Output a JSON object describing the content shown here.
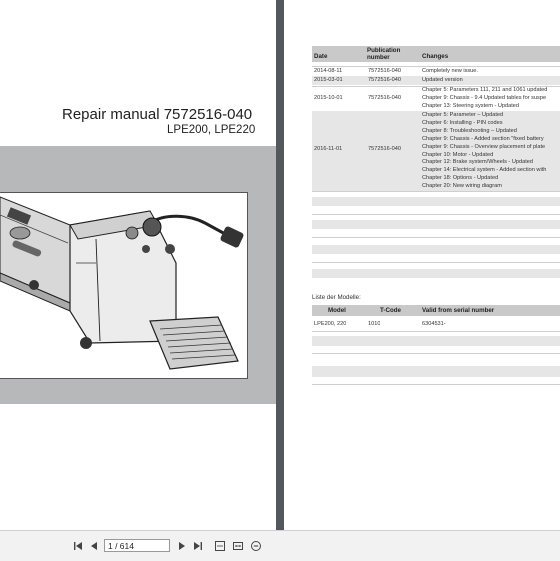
{
  "cover": {
    "title": "Repair manual 7572516-040",
    "subtitle": "LPE200, LPE220"
  },
  "revision_table": {
    "headers": {
      "date": "Date",
      "publication_number": "Publication number",
      "changes": "Changes"
    },
    "rows": [
      {
        "date": "2014-08-11",
        "publication_number": "7572516-040",
        "changes": [
          "Completely new issue."
        ]
      },
      {
        "date": "2015-03-01",
        "publication_number": "7572516-040",
        "changes": [
          "Updated version"
        ]
      },
      {
        "date": "2015-10-01",
        "publication_number": "7572516-040",
        "changes": [
          "Chapter 5: Parameters 111, 211 and 1061 updated",
          "Chapter 9: Chassis - 9.4 Updated tables for suspe",
          "Chapter 13: Steering system - Updated"
        ]
      },
      {
        "date": "2016-11-01",
        "publication_number": "7572516-040",
        "changes": [
          "Chapter 5: Parameter – Updated",
          "Chapter 6: Installing - PIN codes",
          "Chapter 8: Troubleshooting – Updated",
          "Chapter 9: Chassis - Added section \"fixed battery",
          "Chapter 9: Chassis - Overview placement of plate",
          "Chapter 10: Motor - Updated",
          "Chapter 12: Brake system/Wheels - Updated",
          "Chapter 14: Electrical system - Added section with",
          "Chapter 18: Options - Updated",
          "Chapter 20: New wiring diagram"
        ]
      }
    ]
  },
  "models_table": {
    "caption": "Liste der Modelle:",
    "headers": {
      "model": "Model",
      "tcode": "T-Code",
      "valid_from": "Valid from serial number"
    },
    "rows": [
      {
        "model": "LPE200, 220",
        "tcode": "1010",
        "valid_from": "6304531-"
      }
    ]
  },
  "toolbar": {
    "page_indicator": "1 / 614",
    "icons": {
      "first": "first-page-icon",
      "prev": "previous-page-icon",
      "next": "next-page-icon",
      "last": "last-page-icon",
      "fit_page": "fit-page-icon",
      "fit_width": "fit-width-icon",
      "zoom_out": "zoom-out-icon"
    }
  },
  "colors": {
    "viewer_background": "#54575b",
    "page": "#ffffff",
    "cover_band": "#b7b8ba",
    "table_header": "#c9c9c9",
    "table_row_band": "#e6e6e6",
    "toolbar": "#f2f2f2"
  }
}
